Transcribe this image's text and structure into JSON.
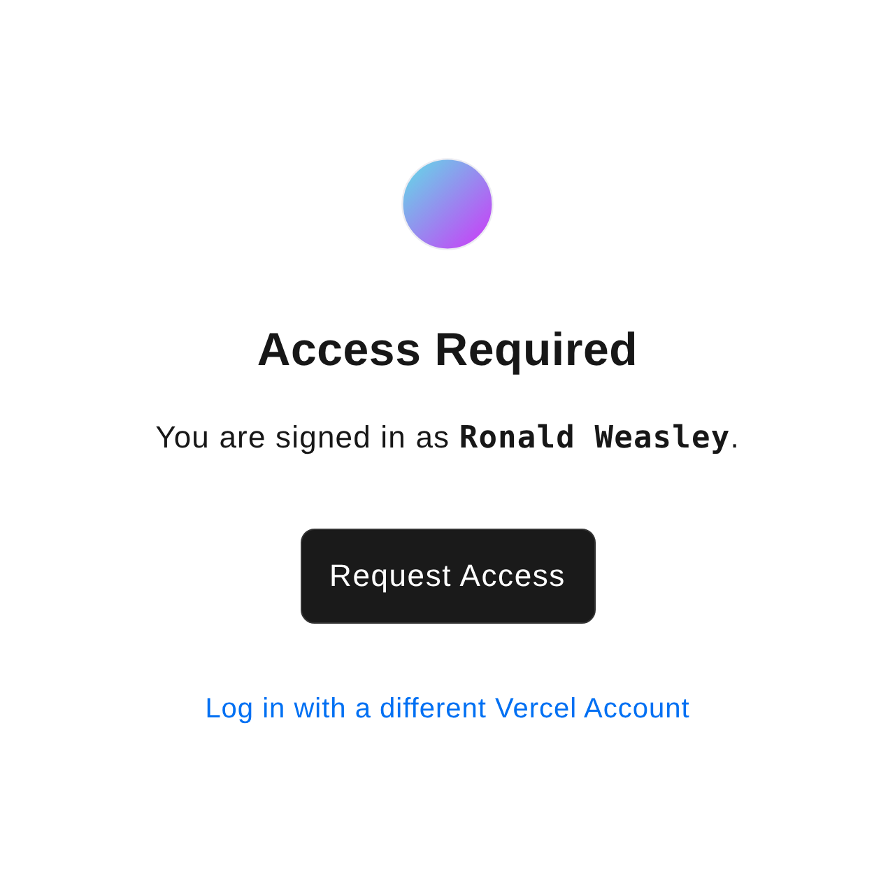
{
  "title": "Access Required",
  "message": "You are signed in as **Ronald Weasley**.",
  "button": {
    "label": "Request Access"
  },
  "link": {
    "label": "Log in with a different Vercel Account"
  }
}
